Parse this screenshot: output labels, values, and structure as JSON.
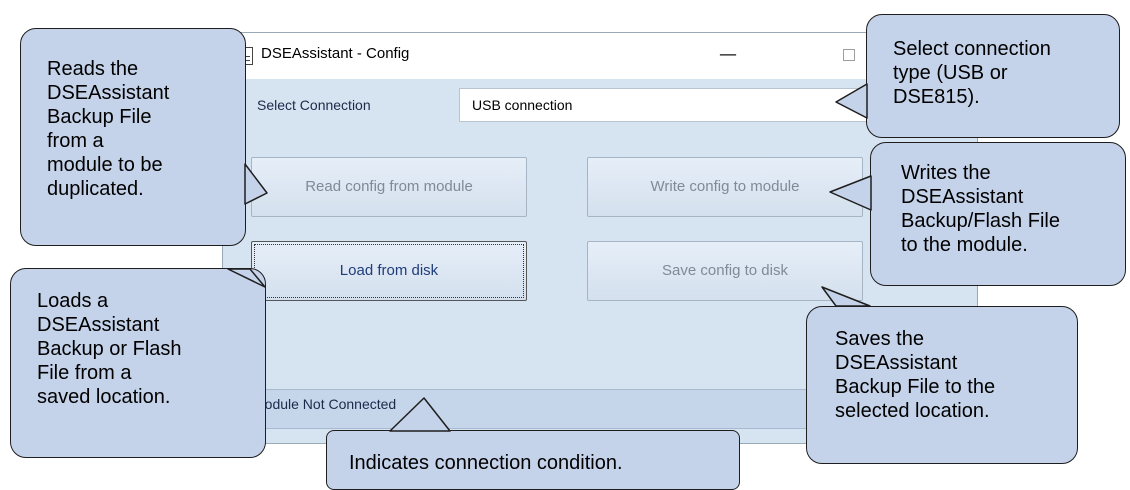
{
  "window": {
    "title": "DSEAssistant - Config",
    "minimize_glyph": "—",
    "connection_label": "Select Connection",
    "connection_value": "USB connection",
    "buttons": {
      "read": "Read config from module",
      "write": "Write config to module",
      "load": "Load from disk",
      "save": "Save config to disk"
    },
    "status": "Module Not Connected"
  },
  "callouts": {
    "read": "Reads the\nDSEAssistant\nBackup File\nfrom a\nmodule to be\nduplicated.",
    "select": "Select connection\ntype (USB or\nDSE815).",
    "write": "Writes the\nDSEAssistant\nBackup/Flash File\nto the module.",
    "load": "Loads a\nDSEAssistant\nBackup or Flash\nFile from a\nsaved location.",
    "save": "Saves the\nDSEAssistant\nBackup File to the\nselected location.",
    "status": "Indicates connection condition."
  }
}
